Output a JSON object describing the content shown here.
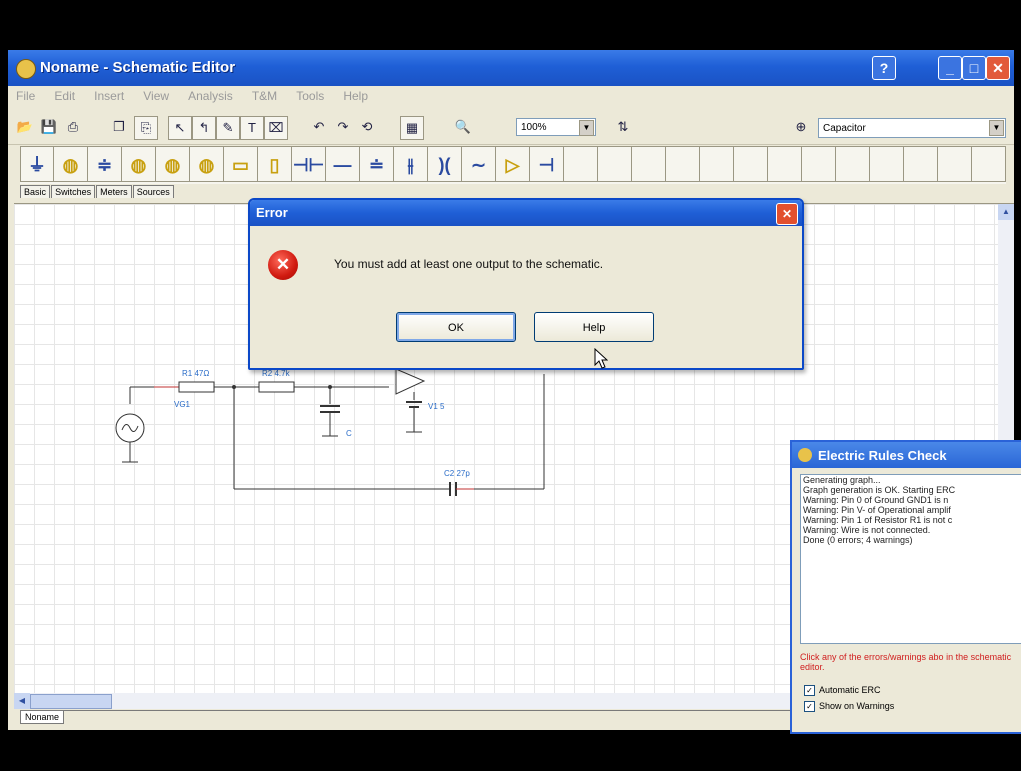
{
  "window": {
    "title": "Noname - Schematic Editor",
    "controls": {
      "minimize": "_",
      "maximize": "□",
      "close": "✕"
    }
  },
  "menu": [
    "File",
    "Edit",
    "Insert",
    "View",
    "Analysis",
    "T&M",
    "Tools",
    "Help"
  ],
  "toolbar": {
    "zoom_value": "100%",
    "component_value": "Capacitor"
  },
  "palette_tabs": [
    "Basic",
    "Switches",
    "Meters",
    "Sources"
  ],
  "schematic": {
    "labels": {
      "r1": "R1 47Ω",
      "r2": "R2 4.7k",
      "vg1": "VG1",
      "c1_name": "C",
      "v1": "V1 5",
      "c2": "C2 27p"
    }
  },
  "document_tab": "Noname",
  "dialog": {
    "title": "Error",
    "message": "You must add at least one output to the schematic.",
    "ok_label": "OK",
    "help_label": "Help"
  },
  "erc": {
    "title": "Electric Rules Check",
    "log": [
      "Generating graph...",
      "Graph generation is OK. Starting ERC",
      "Warning: Pin 0 of Ground GND1 is n",
      "Warning: Pin V- of Operational amplif",
      "Warning: Pin 1 of Resistor R1 is not c",
      "Warning: Wire is not connected.",
      "Done (0 errors; 4 warnings)"
    ],
    "hint": "Click any of the errors/warnings abo in the schematic editor.",
    "checkbox_auto": "Automatic ERC",
    "checkbox_warn": "Show on Warnings"
  }
}
